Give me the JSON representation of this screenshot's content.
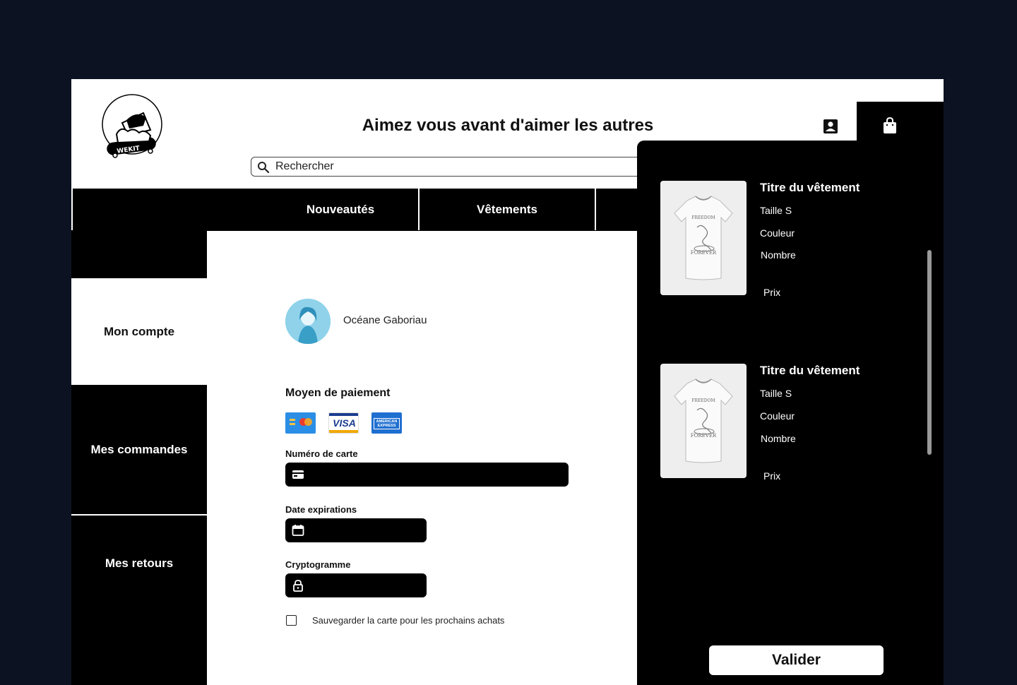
{
  "header": {
    "headline": "Aimez vous avant d'aimer les autres",
    "search_placeholder": "Rechercher",
    "logo_text": "WEKIT"
  },
  "nav": {
    "items": [
      {
        "label": "Nouveautés"
      },
      {
        "label": "Vêtements"
      }
    ]
  },
  "sidebar": {
    "items": [
      {
        "label": "Mon compte",
        "active": true
      },
      {
        "label": "Mes commandes",
        "active": false
      },
      {
        "label": "Mes retours",
        "active": false
      }
    ]
  },
  "profile": {
    "name": "Océane Gaboriau"
  },
  "payment": {
    "title": "Moyen de paiement",
    "card_brands": [
      "mastercard-icon",
      "visa-icon",
      "amex-icon"
    ],
    "visa_text": "VISA",
    "amex_text": "AMERICAN EXPRESS",
    "card_number_label": "Numéro de carte",
    "expiry_label": "Date expirations",
    "cvv_label": "Cryptogramme",
    "save_card_label": "Sauvegarder la carte pour les prochains achats",
    "save_card_checked": false
  },
  "cart": {
    "items": [
      {
        "title": "Titre du vêtement",
        "size": "Taille S",
        "color": "Couleur",
        "quantity": "Nombre",
        "price": "Prix",
        "print_top": "FREEDOM",
        "print_bottom": "FOREVER"
      },
      {
        "title": "Titre du vêtement",
        "size": "Taille S",
        "color": "Couleur",
        "quantity": "Nombre",
        "price": "Prix",
        "print_top": "FREEDOM",
        "print_bottom": "FOREVER"
      }
    ],
    "validate_label": "Valider"
  },
  "colors": {
    "background": "#0d1222",
    "primary": "#000000",
    "surface": "#ffffff"
  }
}
